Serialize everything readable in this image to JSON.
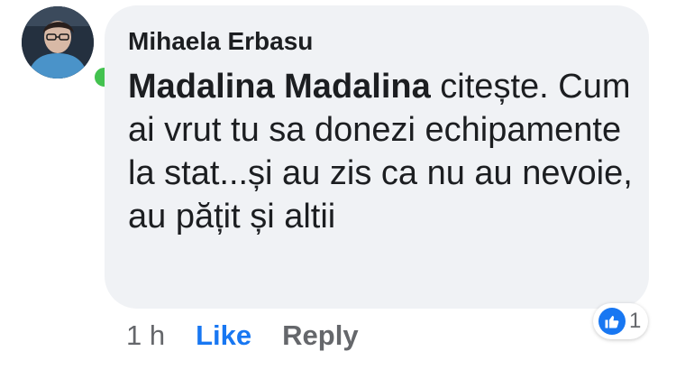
{
  "comment": {
    "author": "Mihaela Erbasu",
    "mention": "Madalina Madalina",
    "text": " citește. Cum ai vrut tu sa donezi echipamente la stat...și au zis ca nu au nevoie, au pățit și altii",
    "online": true
  },
  "actions": {
    "timestamp": "1 h",
    "like_label": "Like",
    "reply_label": "Reply"
  },
  "reactions": {
    "icon": "thumbs-up-icon",
    "count": "1"
  },
  "colors": {
    "bubble": "#f0f2f5",
    "accent": "#1877f2",
    "online": "#43c24f",
    "muted": "#65676b"
  }
}
